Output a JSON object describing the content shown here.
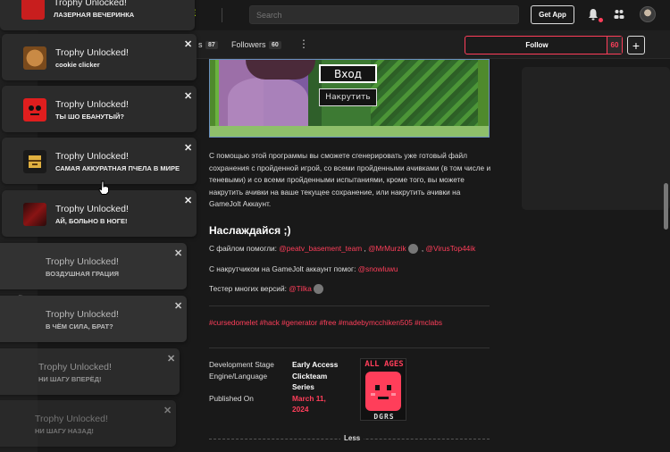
{
  "topbar": {
    "tab_partial": "E",
    "search_placeholder": "Search",
    "get_app_label": "Get App"
  },
  "profile_bar": {
    "following_partial": "s",
    "following_count": "87",
    "followers_label": "Followers",
    "followers_count": "60",
    "more_label": "⋮",
    "follow_label": "Follow",
    "follow_count": "60",
    "plus_label": "+"
  },
  "game_image": {
    "login_button": "Вход",
    "boost_button": "Накрутить"
  },
  "post": {
    "description": "С помощью этой программы вы сможете сгенерировать уже готовый файл сохранения с пройденной игрой, со всеми пройденными ачивками (в том числе и теневыми) и со всеми пройденными испытаниями, кроме того, вы можете накрутить ачивки на ваше текущее сохранение, или накрутить ачивки на GameJolt Аккаунт.",
    "enjoy": "Наслаждайся ;)",
    "helpers_prefix": "С файлом помогли: ",
    "helper_1": "@peatv_basement_team",
    "helper_sep_1": " , ",
    "helper_2": "@MrMurzik",
    "helper_sep_2": " , ",
    "helper_3": "@VirusTop44ik",
    "boost_help_prefix": "С накрутчиком на GameJolt аккаунт помог: ",
    "boost_helper": "@snowluwu",
    "tester_prefix": "Тестер многих версий: ",
    "tester": "@Tilka",
    "tags": "#cursedomelet #hack #generator #free #madebymcchiken505 #mclabs"
  },
  "details": {
    "stage_label": "Development Stage",
    "stage_value": "Early Access",
    "engine_label": "Engine/Language",
    "engine_value_1": "Clickteam",
    "engine_value_2": "Series",
    "published_label": "Published On",
    "published_value_1": "March 11,",
    "published_value_2": "2024",
    "rating_top": "ALL AGES",
    "rating_bottom": "DGRS",
    "less_label": "Less"
  },
  "notifications": [
    {
      "title": "Trophy Unlocked!",
      "text": "ЛАЗЕРНАЯ ВЕЧЕРИНКА",
      "close": "✕",
      "icon": "red-character-icon",
      "color": "#c81e1e"
    },
    {
      "title": "Trophy Unlocked!",
      "text": "cookie clicker",
      "close": "✕",
      "icon": "cookie-icon",
      "color": "#a66a2c"
    },
    {
      "title": "Trophy Unlocked!",
      "text": "ТЫ ШО ЕБАНУТЫЙ?",
      "close": "✕",
      "icon": "red-face-icon",
      "color": "#e01e1e"
    },
    {
      "title": "Trophy Unlocked!",
      "text": "САМАЯ АККУРАТНАЯ ПЧЕЛА В МИРЕ",
      "close": "✕",
      "icon": "bee-icon",
      "color": "#e0b040"
    },
    {
      "title": "Trophy Unlocked!",
      "text": "АЙ, БОЛЬНО В НОГЕ!",
      "close": "✕",
      "icon": "blood-icon",
      "color": "#6a1010"
    },
    {
      "title": "Trophy Unlocked!",
      "text": "ВОЗДУШНАЯ ГРАЦИЯ",
      "close": "✕"
    },
    {
      "title": "Trophy Unlocked!",
      "text": "В ЧЁМ СИЛА, БРАТ?",
      "close": "✕"
    },
    {
      "title": "Trophy Unlocked!",
      "text": "НИ ШАГУ ВПЕРЁД!",
      "close": "✕"
    },
    {
      "title": "Trophy Unlocked!",
      "text": "НИ ШАГУ НАЗАД!",
      "close": "✕"
    }
  ],
  "colors": {
    "accent": "#ff3e5a",
    "highlight": "#ccff00",
    "background": "#191919"
  }
}
